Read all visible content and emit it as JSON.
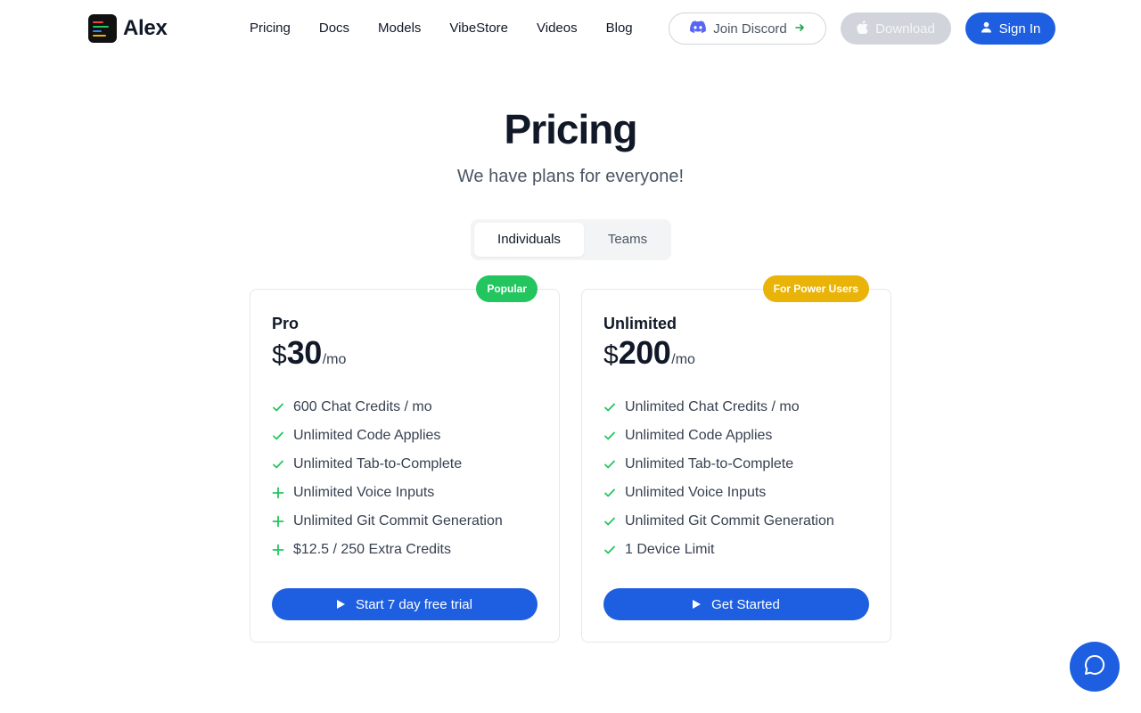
{
  "header": {
    "brand": "Alex",
    "nav": [
      "Pricing",
      "Docs",
      "Models",
      "VibeStore",
      "Videos",
      "Blog"
    ],
    "discord_label": "Join Discord",
    "download_label": "Download",
    "signin_label": "Sign In"
  },
  "hero": {
    "title": "Pricing",
    "subtitle": "We have plans for everyone!"
  },
  "toggle": {
    "options": [
      "Individuals",
      "Teams"
    ],
    "selected": "Individuals"
  },
  "plans": [
    {
      "name": "Pro",
      "currency": "$",
      "price": "30",
      "period": "/mo",
      "badge": "Popular",
      "badge_color": "#22c55e",
      "features": [
        {
          "text": "600 Chat Credits / mo",
          "icon": "check-icon"
        },
        {
          "text": "Unlimited Code Applies",
          "icon": "check-icon"
        },
        {
          "text": "Unlimited Tab-to-Complete",
          "icon": "check-icon"
        },
        {
          "text": "Unlimited Voice Inputs",
          "icon": "plus-icon"
        },
        {
          "text": "Unlimited Git Commit Generation",
          "icon": "plus-icon"
        },
        {
          "text": "$12.5 / 250 Extra Credits",
          "icon": "plus-icon"
        }
      ],
      "cta": "Start 7 day free trial"
    },
    {
      "name": "Unlimited",
      "currency": "$",
      "price": "200",
      "period": "/mo",
      "badge": "For Power Users",
      "badge_color": "#eab308",
      "features": [
        {
          "text": "Unlimited Chat Credits / mo",
          "icon": "check-icon"
        },
        {
          "text": "Unlimited Code Applies",
          "icon": "check-icon"
        },
        {
          "text": "Unlimited Tab-to-Complete",
          "icon": "check-icon"
        },
        {
          "text": "Unlimited Voice Inputs",
          "icon": "check-icon"
        },
        {
          "text": "Unlimited Git Commit Generation",
          "icon": "check-icon"
        },
        {
          "text": "1 Device Limit",
          "icon": "check-icon"
        }
      ],
      "cta": "Get Started"
    }
  ],
  "colors": {
    "accent": "#1d5fe0",
    "feature_icon": "#22c55e",
    "text": "#111827",
    "muted": "#4b5563"
  },
  "icons": {
    "discord": "discord-icon",
    "apple": "apple-icon",
    "user": "user-icon",
    "play": "play-icon",
    "chat": "chat-bubble-icon",
    "arrow": "arrow-right-icon"
  }
}
